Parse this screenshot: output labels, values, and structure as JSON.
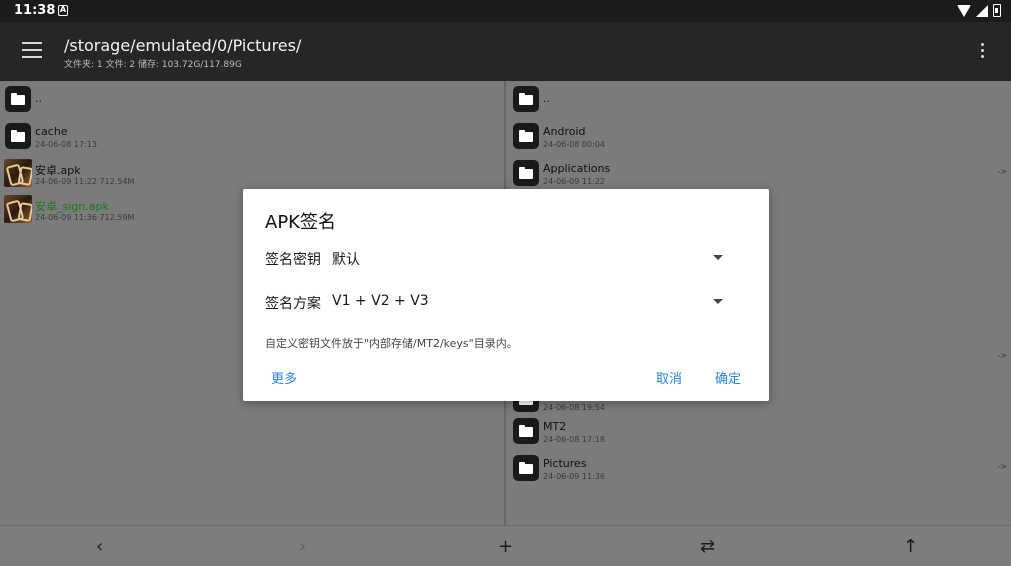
{
  "status": {
    "time": "11:38",
    "app_badge": "A"
  },
  "toolbar": {
    "path": "/storage/emulated/0/Pictures/",
    "info": "文件夹: 1  文件: 2  储存: 103.72G/117.89G"
  },
  "left_pane": {
    "items": [
      {
        "name": "..",
        "meta": "",
        "type": "folder"
      },
      {
        "name": "cache",
        "meta": "24-06-08 17:13",
        "type": "folder"
      },
      {
        "name": "安卓.apk",
        "meta": "24-06-09 11:22  712.54M",
        "type": "apk"
      },
      {
        "name": "安卓_sign.apk",
        "meta": "24-06-09 11:36  712.59M",
        "type": "apk"
      }
    ]
  },
  "right_pane": {
    "items": [
      {
        "name": "..",
        "meta": ""
      },
      {
        "name": "Android",
        "meta": "24-06-08 00:04"
      },
      {
        "name": "Applications",
        "meta": "24-06-09 11:22",
        "tag": "->"
      },
      {
        "name": "",
        "meta": "24-06-08 19:54"
      },
      {
        "name": "MT2",
        "meta": "24-06-08 17:18"
      },
      {
        "name": "Pictures",
        "meta": "24-06-09 11:36",
        "tag": "->"
      }
    ],
    "extra_tag": "->"
  },
  "dialog": {
    "title": "APK签名",
    "key_label": "签名密钥",
    "key_value": "默认",
    "scheme_label": "签名方案",
    "scheme_value": "V1 + V2 + V3",
    "hint": "自定义密钥文件放于\"内部存储/MT2/keys\"目录内。",
    "more": "更多",
    "cancel": "取消",
    "ok": "确定"
  },
  "bottom_nav": {
    "back": "‹",
    "forward": "›",
    "add": "+",
    "swap": "⇄",
    "up": "↑"
  }
}
